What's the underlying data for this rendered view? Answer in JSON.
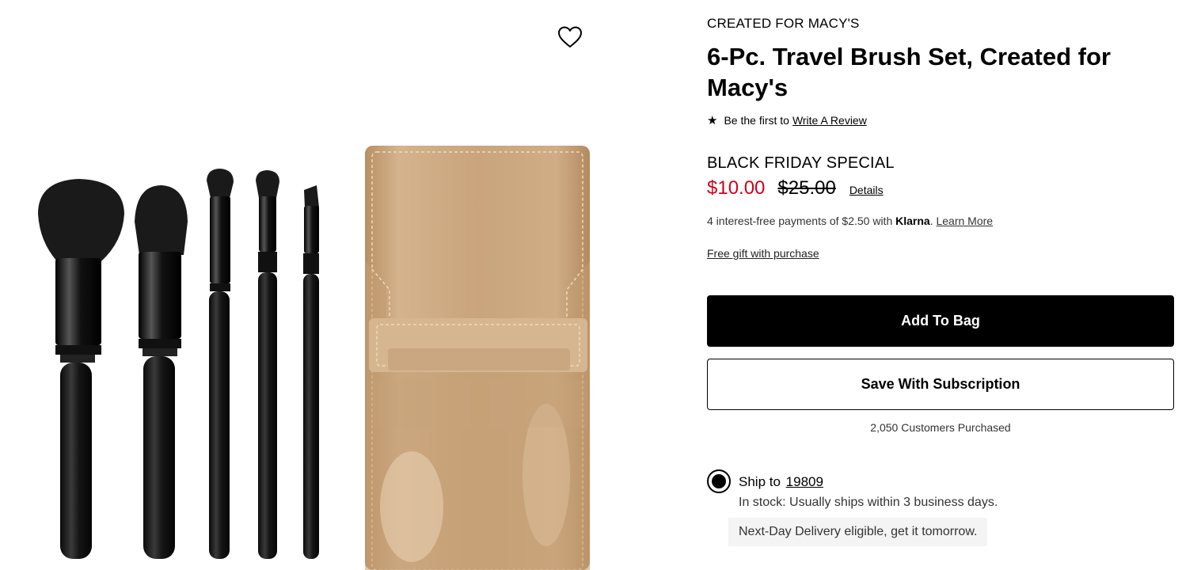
{
  "product": {
    "brand": "CREATED FOR MACY'S",
    "title": "6-Pc. Travel Brush Set, Created for Macy's",
    "image_alt": "6-Pc. Travel Brush Set with tan patent pouch"
  },
  "reviews": {
    "prompt": "Be the first to",
    "link": "Write A Review"
  },
  "pricing": {
    "promo_label": "BLACK FRIDAY SPECIAL",
    "sale_price": "$10.00",
    "original_price": "$25.00",
    "details_link": "Details"
  },
  "klarna": {
    "text_before": "4 interest-free payments of $2.50 with ",
    "brand": "Klarna",
    "text_after": ". ",
    "link": "Learn More"
  },
  "gift_link": "Free gift with purchase",
  "actions": {
    "add_to_bag": "Add To Bag",
    "subscription": "Save With Subscription",
    "purchased": "2,050 Customers Purchased"
  },
  "shipping": {
    "label": "Ship to",
    "zip": "19809",
    "stock": "In stock: Usually ships within 3 business days.",
    "next_day": "Next-Day Delivery eligible, get it tomorrow."
  },
  "colors": {
    "sale_red": "#d0021b",
    "pouch_tan": "#c8a57e"
  },
  "icons": {
    "wishlist": "heart-outline-icon",
    "rating": "star-icon"
  }
}
